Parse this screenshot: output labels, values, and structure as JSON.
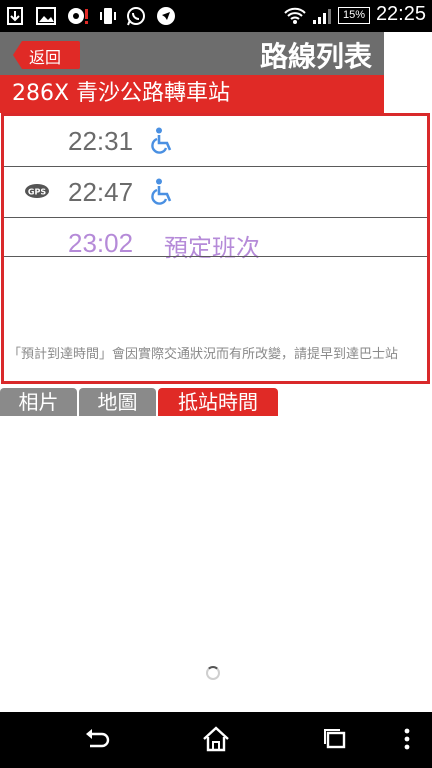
{
  "status_bar": {
    "battery": "15%",
    "time": "22:25",
    "icons": [
      "download-notification-icon",
      "image-notification-icon",
      "alert-bubble-icon",
      "phone-vibrate-icon",
      "whatsapp-icon",
      "navigation-icon",
      "wifi-icon",
      "signal-icon",
      "battery-icon"
    ]
  },
  "header": {
    "back_label": "返回",
    "title": "路線列表"
  },
  "route": {
    "title": "286X 青沙公路轉車站"
  },
  "arrivals": [
    {
      "time": "22:31",
      "scheduled_label": "",
      "gps": false,
      "wheelchair": true
    },
    {
      "time": "22:47",
      "scheduled_label": "",
      "gps": true,
      "wheelchair": true
    },
    {
      "time": "23:02",
      "scheduled_label": "預定班次",
      "gps": false,
      "wheelchair": false
    }
  ],
  "gps_badge_text": "GPS",
  "note": "「預計到達時間」會因實際交通狀況而有所改變，請提早到達巴士站",
  "tabs": [
    {
      "label": "相片",
      "active": false
    },
    {
      "label": "地圖",
      "active": false
    },
    {
      "label": "抵站時間",
      "active": true
    }
  ],
  "colors": {
    "accent_red": "#e02a26",
    "header_gray": "#6d6d6d",
    "scheduled_purple": "#b58ad8",
    "wheelchair_blue": "#4a90e2"
  }
}
